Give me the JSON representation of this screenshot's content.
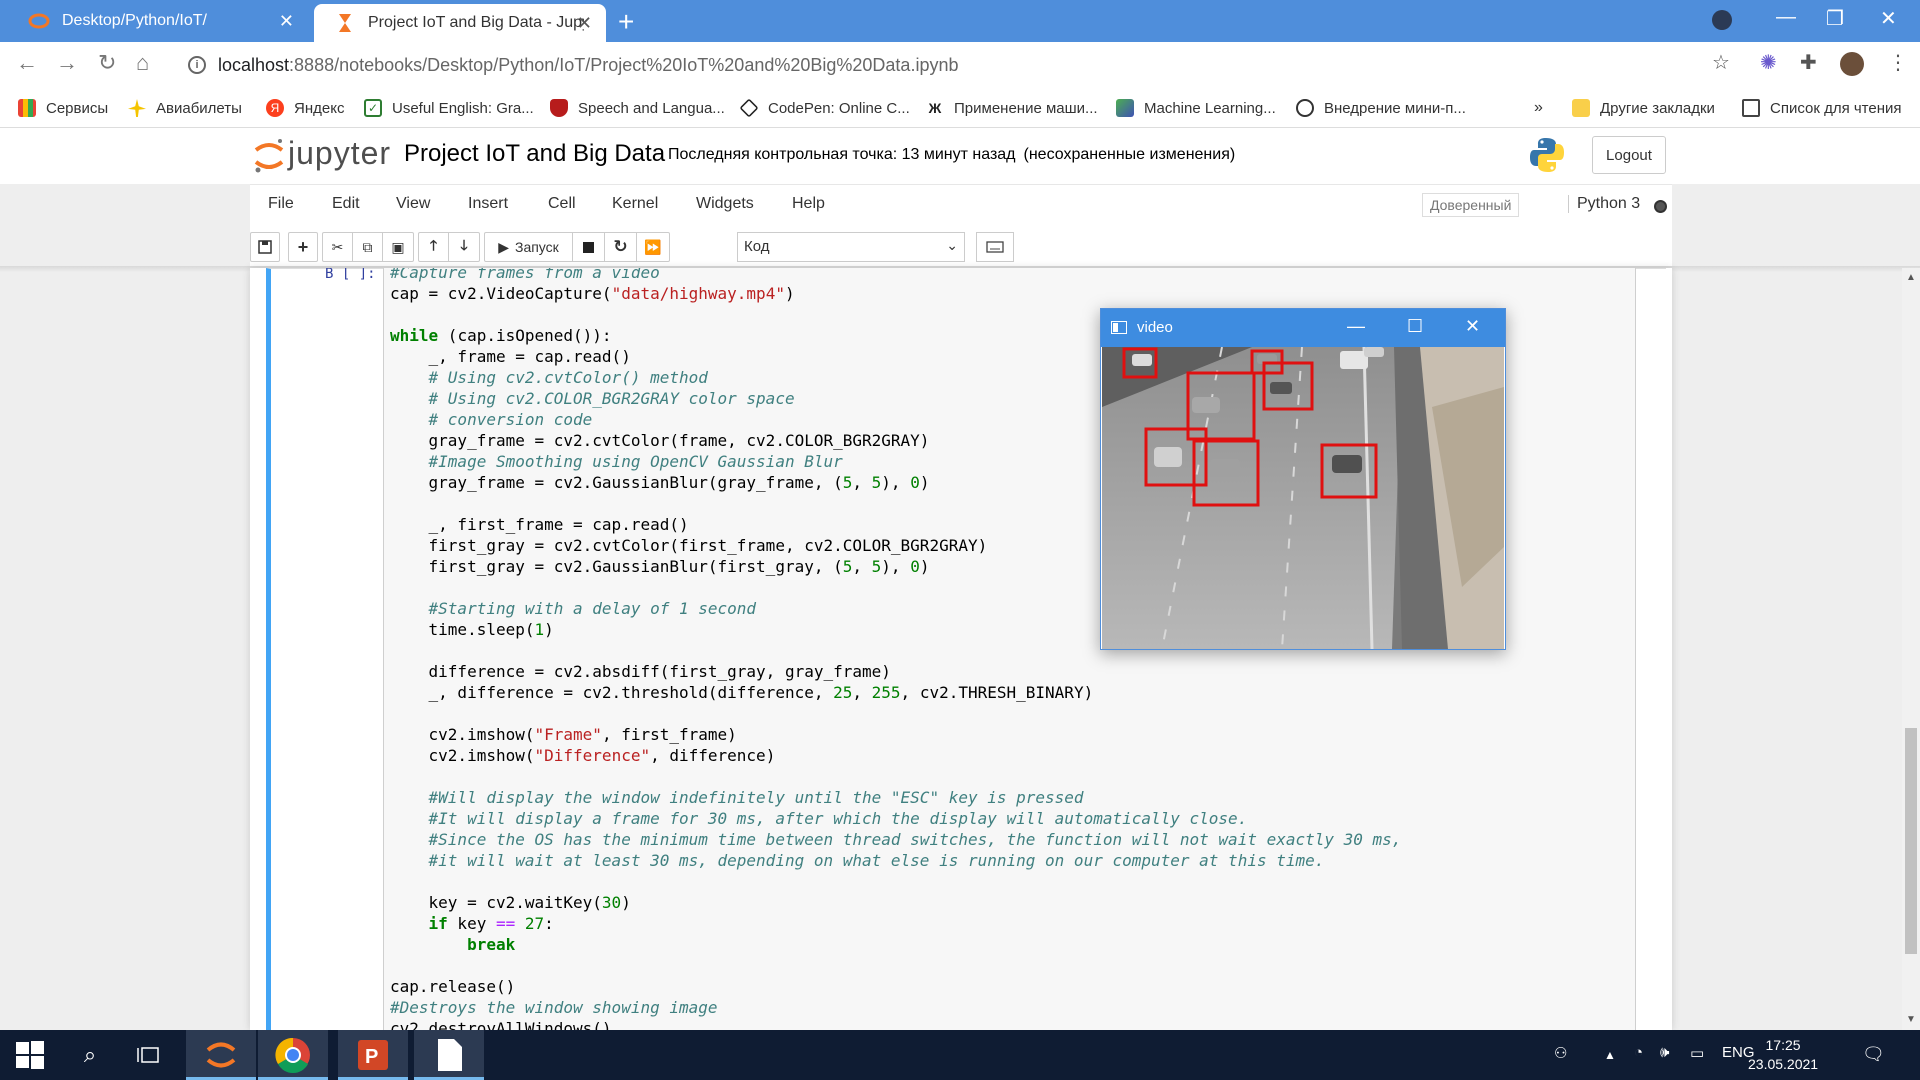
{
  "browser": {
    "tabs": [
      {
        "title": "Desktop/Python/IoT/",
        "active": false
      },
      {
        "title": "Project IoT and Big Data - Jupyte",
        "active": true
      }
    ],
    "url_host": "localhost",
    "url_path": ":8888/notebooks/Desktop/Python/IoT/Project%20IoT%20and%20Big%20Data.ipynb",
    "bookmarks": [
      "Сервисы",
      "Авиабилеты",
      "Яндекс",
      "Useful English: Gra...",
      "Speech and Langua...",
      "CodePen: Online C...",
      "Применение маши...",
      "Machine Learning...",
      "Внедрение мини-п...",
      "Другие закладки",
      "Список для чтения"
    ],
    "more_bookmarks": "»"
  },
  "jupyter": {
    "logo_text": "jupyter",
    "notebook_name": "Project IoT and Big Data",
    "checkpoint": "Последняя контрольная точка: 13 минут назад",
    "unsaved": "(несохраненные изменения)",
    "logout": "Logout",
    "menu": [
      "File",
      "Edit",
      "View",
      "Insert",
      "Cell",
      "Kernel",
      "Widgets",
      "Help"
    ],
    "trusted": "Доверенный",
    "kernel": "Python 3",
    "run_label": "Запуск",
    "cell_type": "Код"
  },
  "cell": {
    "prompt": "В [ ]:"
  },
  "video_window": {
    "title": "video"
  },
  "taskbar": {
    "language": "ENG",
    "time": "17:25",
    "date": "23.05.2021"
  },
  "colors": {
    "tab_strip": "#4f8edb",
    "cell_selected_border": "#42a5f5",
    "jupyter_orange": "#f37726",
    "taskbar": "#0f1c33",
    "bbox_red": "#e01010"
  }
}
